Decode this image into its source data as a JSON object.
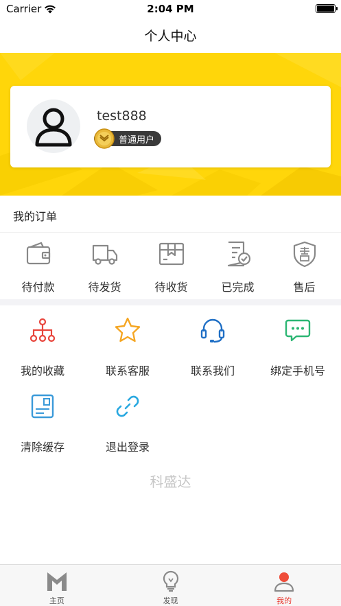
{
  "status_bar": {
    "carrier": "Carrier",
    "time": "2:04 PM"
  },
  "nav": {
    "title": "个人中心"
  },
  "profile": {
    "username": "test888",
    "badge": "普通用户"
  },
  "orders": {
    "title": "我的订单",
    "items": [
      {
        "label": "待付款",
        "icon": "wallet-icon"
      },
      {
        "label": "待发货",
        "icon": "truck-icon"
      },
      {
        "label": "待收货",
        "icon": "package-icon"
      },
      {
        "label": "已完成",
        "icon": "completed-document-icon"
      },
      {
        "label": "售后",
        "icon": "after-sales-shield-icon"
      }
    ]
  },
  "services": [
    {
      "label": "我的收藏",
      "icon": "network-icon",
      "color": "#e8453c"
    },
    {
      "label": "联系客服",
      "icon": "star-icon",
      "color": "#f5a623"
    },
    {
      "label": "联系我们",
      "icon": "headset-icon",
      "color": "#1f6fc5"
    },
    {
      "label": "绑定手机号",
      "icon": "chat-bubble-icon",
      "color": "#2bb673"
    },
    {
      "label": "清除缓存",
      "icon": "card-icon",
      "color": "#3a9ad9"
    },
    {
      "label": "退出登录",
      "icon": "link-icon",
      "color": "#29a8e0"
    }
  ],
  "brand": "科盛达",
  "tabs": [
    {
      "label": "主页",
      "icon": "m-logo-icon"
    },
    {
      "label": "发现",
      "icon": "lightbulb-icon"
    },
    {
      "label": "我的",
      "icon": "profile-icon",
      "active": true
    }
  ],
  "colors": {
    "accent_yellow": "#ffd60a",
    "active_tab": "#e8392f"
  }
}
